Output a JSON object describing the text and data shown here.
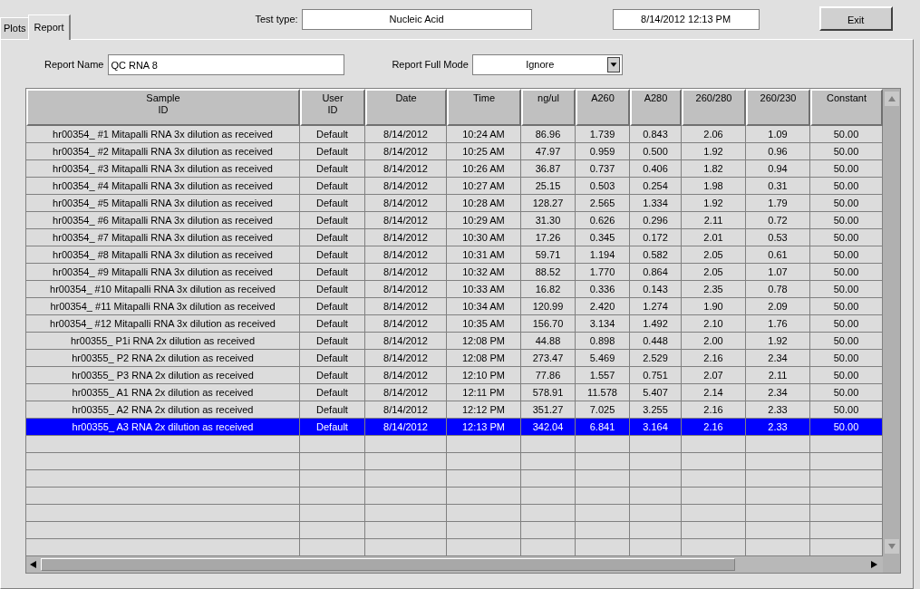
{
  "tabs": [
    {
      "label": "Plots",
      "selected": false
    },
    {
      "label": "Report",
      "selected": true
    }
  ],
  "test_type": {
    "label": "Test type:",
    "value": "Nucleic Acid"
  },
  "datetime": "8/14/2012  12:13 PM",
  "exit_button": "Exit",
  "report_name": {
    "label": "Report Name",
    "value": "QC RNA 8"
  },
  "report_full_mode": {
    "label": "Report Full Mode",
    "value": "Ignore"
  },
  "table": {
    "columns": [
      "Sample\nID",
      "User\nID",
      "Date",
      "Time",
      "ng/ul",
      "A260",
      "A280",
      "260/280",
      "260/230",
      "Constant"
    ],
    "rows": [
      {
        "cells": [
          "hr00354_ #1 Mitapalli RNA 3x dilution as received",
          "Default",
          "8/14/2012",
          "10:24 AM",
          "86.96",
          "1.739",
          "0.843",
          "2.06",
          "1.09",
          "50.00"
        ],
        "selected": false
      },
      {
        "cells": [
          "hr00354_ #2 Mitapalli RNA 3x dilution as received",
          "Default",
          "8/14/2012",
          "10:25 AM",
          "47.97",
          "0.959",
          "0.500",
          "1.92",
          "0.96",
          "50.00"
        ],
        "selected": false
      },
      {
        "cells": [
          "hr00354_ #3 Mitapalli RNA 3x dilution as received",
          "Default",
          "8/14/2012",
          "10:26 AM",
          "36.87",
          "0.737",
          "0.406",
          "1.82",
          "0.94",
          "50.00"
        ],
        "selected": false
      },
      {
        "cells": [
          "hr00354_ #4 Mitapalli RNA 3x dilution as received",
          "Default",
          "8/14/2012",
          "10:27 AM",
          "25.15",
          "0.503",
          "0.254",
          "1.98",
          "0.31",
          "50.00"
        ],
        "selected": false
      },
      {
        "cells": [
          "hr00354_ #5 Mitapalli RNA 3x dilution as received",
          "Default",
          "8/14/2012",
          "10:28 AM",
          "128.27",
          "2.565",
          "1.334",
          "1.92",
          "1.79",
          "50.00"
        ],
        "selected": false
      },
      {
        "cells": [
          "hr00354_ #6 Mitapalli RNA 3x dilution as received",
          "Default",
          "8/14/2012",
          "10:29 AM",
          "31.30",
          "0.626",
          "0.296",
          "2.11",
          "0.72",
          "50.00"
        ],
        "selected": false
      },
      {
        "cells": [
          "hr00354_ #7 Mitapalli RNA 3x dilution as received",
          "Default",
          "8/14/2012",
          "10:30 AM",
          "17.26",
          "0.345",
          "0.172",
          "2.01",
          "0.53",
          "50.00"
        ],
        "selected": false
      },
      {
        "cells": [
          "hr00354_ #8 Mitapalli RNA 3x dilution as received",
          "Default",
          "8/14/2012",
          "10:31 AM",
          "59.71",
          "1.194",
          "0.582",
          "2.05",
          "0.61",
          "50.00"
        ],
        "selected": false
      },
      {
        "cells": [
          "hr00354_ #9 Mitapalli RNA 3x dilution as received",
          "Default",
          "8/14/2012",
          "10:32 AM",
          "88.52",
          "1.770",
          "0.864",
          "2.05",
          "1.07",
          "50.00"
        ],
        "selected": false
      },
      {
        "cells": [
          "hr00354_ #10 Mitapalli RNA 3x dilution as received",
          "Default",
          "8/14/2012",
          "10:33 AM",
          "16.82",
          "0.336",
          "0.143",
          "2.35",
          "0.78",
          "50.00"
        ],
        "selected": false
      },
      {
        "cells": [
          "hr00354_ #11 Mitapalli RNA 3x dilution as received",
          "Default",
          "8/14/2012",
          "10:34 AM",
          "120.99",
          "2.420",
          "1.274",
          "1.90",
          "2.09",
          "50.00"
        ],
        "selected": false
      },
      {
        "cells": [
          "hr00354_ #12 Mitapalli RNA 3x dilution as received",
          "Default",
          "8/14/2012",
          "10:35 AM",
          "156.70",
          "3.134",
          "1.492",
          "2.10",
          "1.76",
          "50.00"
        ],
        "selected": false
      },
      {
        "cells": [
          "hr00355_ P1i RNA 2x dilution as received",
          "Default",
          "8/14/2012",
          "12:08 PM",
          "44.88",
          "0.898",
          "0.448",
          "2.00",
          "1.92",
          "50.00"
        ],
        "selected": false
      },
      {
        "cells": [
          "hr00355_ P2 RNA 2x dilution as received",
          "Default",
          "8/14/2012",
          "12:08 PM",
          "273.47",
          "5.469",
          "2.529",
          "2.16",
          "2.34",
          "50.00"
        ],
        "selected": false
      },
      {
        "cells": [
          "hr00355_ P3 RNA 2x dilution as received",
          "Default",
          "8/14/2012",
          "12:10 PM",
          "77.86",
          "1.557",
          "0.751",
          "2.07",
          "2.11",
          "50.00"
        ],
        "selected": false
      },
      {
        "cells": [
          "hr00355_ A1 RNA 2x dilution as received",
          "Default",
          "8/14/2012",
          "12:11 PM",
          "578.91",
          "11.578",
          "5.407",
          "2.14",
          "2.34",
          "50.00"
        ],
        "selected": false
      },
      {
        "cells": [
          "hr00355_ A2 RNA 2x dilution as received",
          "Default",
          "8/14/2012",
          "12:12 PM",
          "351.27",
          "7.025",
          "3.255",
          "2.16",
          "2.33",
          "50.00"
        ],
        "selected": false
      },
      {
        "cells": [
          "hr00355_ A3 RNA 2x dilution as received",
          "Default",
          "8/14/2012",
          "12:13 PM",
          "342.04",
          "6.841",
          "3.164",
          "2.16",
          "2.33",
          "50.00"
        ],
        "selected": true
      }
    ]
  }
}
